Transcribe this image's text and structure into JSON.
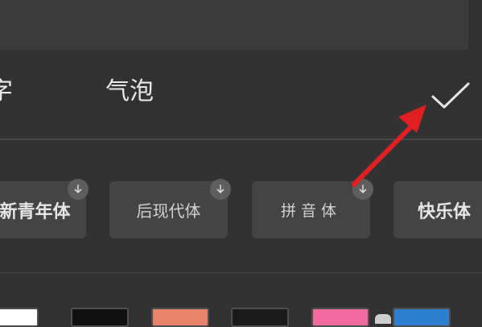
{
  "tabs": [
    {
      "label": "字"
    },
    {
      "label": "气泡"
    }
  ],
  "fonts": [
    {
      "label": "新青年体",
      "download_icon": "download-arrow-icon"
    },
    {
      "label": "后现代体",
      "download_icon": "download-arrow-icon"
    },
    {
      "label": "拼音体",
      "download_icon": "download-arrow-icon"
    },
    {
      "label": "快乐体"
    }
  ],
  "icons": {
    "confirm": "checkmark-icon",
    "annotation": "red-arrow-icon"
  },
  "colors": {
    "background": "#323232",
    "card": "#444444",
    "accent_arrow": "#e02020",
    "swatches": [
      "#ffffff",
      "#111111",
      "#e8846c",
      "#1a1a1a",
      "#f06aa0",
      "#2f7fd0"
    ]
  }
}
